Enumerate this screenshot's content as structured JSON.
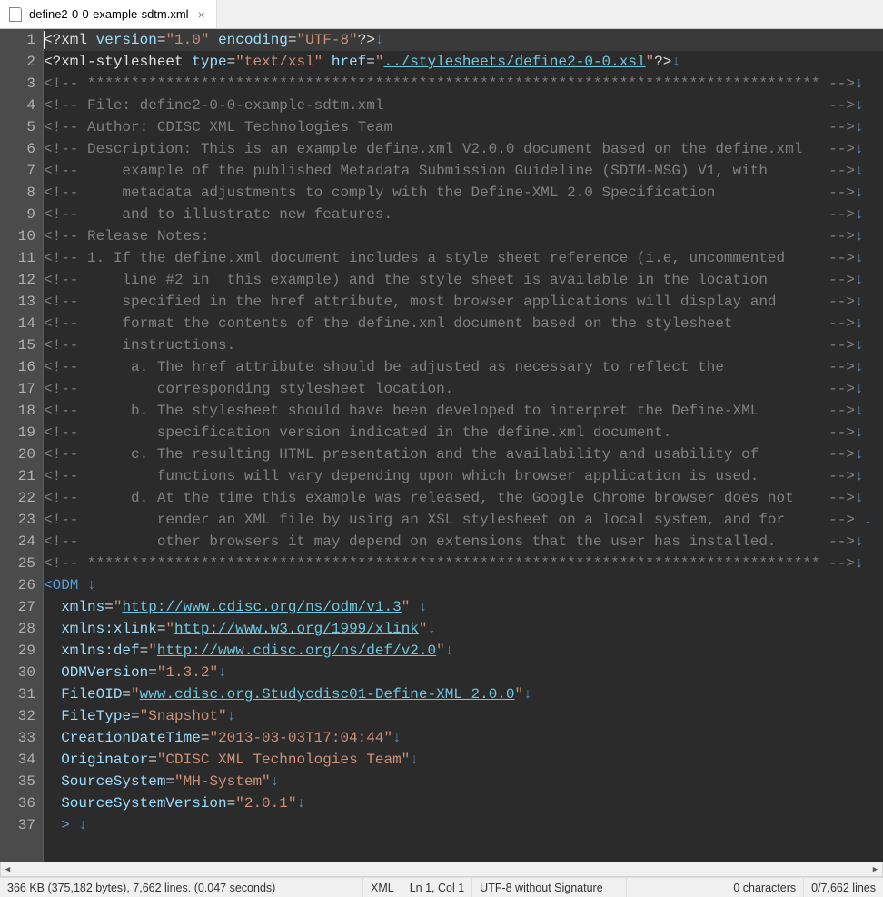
{
  "tab": {
    "filename": "define2-0-0-example-sdtm.xml"
  },
  "status": {
    "fileinfo": "366 KB (375,182 bytes), 7,662 lines. (0.047 seconds)",
    "lang": "XML",
    "pos": "Ln 1, Col 1",
    "encoding": "UTF-8 without Signature",
    "sel_chars": "0 characters",
    "sel_lines": "0/7,662 lines"
  },
  "lines": [
    {
      "n": 1,
      "t": [
        [
          "q",
          "<?"
        ],
        [
          "pi",
          "xml"
        ],
        [
          "q",
          " "
        ],
        [
          "attr",
          "version"
        ],
        [
          "eq",
          "="
        ],
        [
          "str",
          "\"1.0\""
        ],
        [
          "q",
          " "
        ],
        [
          "attr",
          "encoding"
        ],
        [
          "eq",
          "="
        ],
        [
          "str",
          "\"UTF-8\""
        ],
        [
          "q",
          "?>"
        ]
      ]
    },
    {
      "n": 2,
      "t": [
        [
          "q",
          "<?"
        ],
        [
          "pi",
          "xml-stylesheet"
        ],
        [
          "q",
          " "
        ],
        [
          "attr",
          "type"
        ],
        [
          "eq",
          "="
        ],
        [
          "str",
          "\"text/xsl\""
        ],
        [
          "q",
          " "
        ],
        [
          "attr",
          "href"
        ],
        [
          "eq",
          "="
        ],
        [
          "str",
          "\""
        ],
        [
          "url",
          "../stylesheets/define2-0-0.xsl"
        ],
        [
          "str",
          "\""
        ],
        [
          "q",
          "?>"
        ]
      ]
    },
    {
      "n": 3,
      "t": [
        [
          "comment",
          "<!-- ************************************************************************************ -->"
        ]
      ]
    },
    {
      "n": 4,
      "t": [
        [
          "comment",
          "<!-- File: define2-0-0-example-sdtm.xml                                                   -->"
        ]
      ]
    },
    {
      "n": 5,
      "t": [
        [
          "comment",
          "<!-- Author: CDISC XML Technologies Team                                                  -->"
        ]
      ]
    },
    {
      "n": 6,
      "t": [
        [
          "comment",
          "<!-- Description: This is an example define.xml V2.0.0 document based on the define.xml   -->"
        ]
      ]
    },
    {
      "n": 7,
      "t": [
        [
          "comment",
          "<!--     example of the published Metadata Submission Guideline (SDTM-MSG) V1, with       -->"
        ]
      ]
    },
    {
      "n": 8,
      "t": [
        [
          "comment",
          "<!--     metadata adjustments to comply with the Define-XML 2.0 Specification             -->"
        ]
      ]
    },
    {
      "n": 9,
      "t": [
        [
          "comment",
          "<!--     and to illustrate new features.                                                  -->"
        ]
      ]
    },
    {
      "n": 10,
      "t": [
        [
          "comment",
          "<!-- Release Notes:                                                                       -->"
        ]
      ]
    },
    {
      "n": 11,
      "t": [
        [
          "comment",
          "<!-- 1. If the define.xml document includes a style sheet reference (i.e, uncommented     -->"
        ]
      ]
    },
    {
      "n": 12,
      "t": [
        [
          "comment",
          "<!--     line #2 in  this example) and the style sheet is available in the location       -->"
        ]
      ]
    },
    {
      "n": 13,
      "t": [
        [
          "comment",
          "<!--     specified in the href attribute, most browser applications will display and      -->"
        ]
      ]
    },
    {
      "n": 14,
      "t": [
        [
          "comment",
          "<!--     format the contents of the define.xml document based on the stylesheet           -->"
        ]
      ]
    },
    {
      "n": 15,
      "t": [
        [
          "comment",
          "<!--     instructions.                                                                    -->"
        ]
      ]
    },
    {
      "n": 16,
      "t": [
        [
          "comment",
          "<!--      a. The href attribute should be adjusted as necessary to reflect the            -->"
        ]
      ]
    },
    {
      "n": 17,
      "t": [
        [
          "comment",
          "<!--         corresponding stylesheet location.                                           -->"
        ]
      ]
    },
    {
      "n": 18,
      "t": [
        [
          "comment",
          "<!--      b. The stylesheet should have been developed to interpret the Define-XML        -->"
        ]
      ]
    },
    {
      "n": 19,
      "t": [
        [
          "comment",
          "<!--         specification version indicated in the define.xml document.                  -->"
        ]
      ]
    },
    {
      "n": 20,
      "t": [
        [
          "comment",
          "<!--      c. The resulting HTML presentation and the availability and usability of        -->"
        ]
      ]
    },
    {
      "n": 21,
      "t": [
        [
          "comment",
          "<!--         functions will vary depending upon which browser application is used.        -->"
        ]
      ]
    },
    {
      "n": 22,
      "t": [
        [
          "comment",
          "<!--      d. At the time this example was released, the Google Chrome browser does not    -->"
        ]
      ]
    },
    {
      "n": 23,
      "t": [
        [
          "comment",
          "<!--         render an XML file by using an XSL stylesheet on a local system, and for     -->"
        ]
      ],
      "sp": true
    },
    {
      "n": 24,
      "t": [
        [
          "comment",
          "<!--         other browsers it may depend on extensions that the user has installed.      -->"
        ]
      ]
    },
    {
      "n": 25,
      "t": [
        [
          "comment",
          "<!-- ************************************************************************************ -->"
        ]
      ]
    },
    {
      "n": 26,
      "t": [
        [
          "tag",
          "<ODM"
        ]
      ],
      "sp": true
    },
    {
      "n": 27,
      "t": [
        [
          "q",
          "  "
        ],
        [
          "attr",
          "xmlns"
        ],
        [
          "eq",
          "="
        ],
        [
          "str",
          "\""
        ],
        [
          "url",
          "http://www.cdisc.org/ns/odm/v1.3"
        ],
        [
          "str",
          "\""
        ]
      ],
      "sp": true
    },
    {
      "n": 28,
      "t": [
        [
          "q",
          "  "
        ],
        [
          "attr",
          "xmlns:xlink"
        ],
        [
          "eq",
          "="
        ],
        [
          "str",
          "\""
        ],
        [
          "url",
          "http://www.w3.org/1999/xlink"
        ],
        [
          "str",
          "\""
        ]
      ]
    },
    {
      "n": 29,
      "t": [
        [
          "q",
          "  "
        ],
        [
          "attr",
          "xmlns:def"
        ],
        [
          "eq",
          "="
        ],
        [
          "str",
          "\""
        ],
        [
          "url",
          "http://www.cdisc.org/ns/def/v2.0"
        ],
        [
          "str",
          "\""
        ]
      ]
    },
    {
      "n": 30,
      "t": [
        [
          "q",
          "  "
        ],
        [
          "attr",
          "ODMVersion"
        ],
        [
          "eq",
          "="
        ],
        [
          "str",
          "\"1.3.2\""
        ]
      ]
    },
    {
      "n": 31,
      "t": [
        [
          "q",
          "  "
        ],
        [
          "attr",
          "FileOID"
        ],
        [
          "eq",
          "="
        ],
        [
          "str",
          "\""
        ],
        [
          "url",
          "www.cdisc.org.Studycdisc01-Define-XML_2.0.0"
        ],
        [
          "str",
          "\""
        ]
      ]
    },
    {
      "n": 32,
      "t": [
        [
          "q",
          "  "
        ],
        [
          "attr",
          "FileType"
        ],
        [
          "eq",
          "="
        ],
        [
          "str",
          "\"Snapshot\""
        ]
      ]
    },
    {
      "n": 33,
      "t": [
        [
          "q",
          "  "
        ],
        [
          "attr",
          "CreationDateTime"
        ],
        [
          "eq",
          "="
        ],
        [
          "str",
          "\"2013-03-03T17:04:44\""
        ]
      ]
    },
    {
      "n": 34,
      "t": [
        [
          "q",
          "  "
        ],
        [
          "attr",
          "Originator"
        ],
        [
          "eq",
          "="
        ],
        [
          "str",
          "\"CDISC XML Technologies Team\""
        ]
      ]
    },
    {
      "n": 35,
      "t": [
        [
          "q",
          "  "
        ],
        [
          "attr",
          "SourceSystem"
        ],
        [
          "eq",
          "="
        ],
        [
          "str",
          "\"MH-System\""
        ]
      ]
    },
    {
      "n": 36,
      "t": [
        [
          "q",
          "  "
        ],
        [
          "attr",
          "SourceSystemVersion"
        ],
        [
          "eq",
          "="
        ],
        [
          "str",
          "\"2.0.1\""
        ]
      ]
    },
    {
      "n": 37,
      "t": [
        [
          "q",
          "  "
        ],
        [
          "tag",
          ">"
        ]
      ],
      "sp": true
    }
  ]
}
